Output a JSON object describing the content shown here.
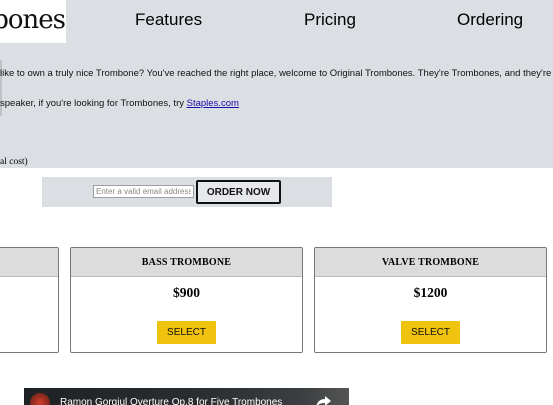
{
  "header": {
    "logo_text": "nbones",
    "nav": [
      "Features",
      "Pricing",
      "Ordering"
    ]
  },
  "intro": {
    "line1": " like to own a truly nice Trombone? You've reached the right place, welcome to Original Trombones. They're Trombones, and they're",
    "line2_prefix": "speaker, if you're looking for Trombones, try ",
    "line2_link": "Staples.com",
    "cost_note": "al cost)"
  },
  "order_form": {
    "email_placeholder": "Enter a valid email address",
    "button_label": "ORDER NOW"
  },
  "cards": [
    {
      "title": "",
      "price": "",
      "button": ""
    },
    {
      "title": "BASS TROMBONE",
      "price": "$900",
      "button": "SELECT"
    },
    {
      "title": "VALVE TROMBONE",
      "price": "$1200",
      "button": "SELECT"
    }
  ],
  "video": {
    "title": "Ramon Gorgiul Overture Op.8 for Five Trombones",
    "share_icon": "share-icon",
    "channel_icon": "channel-avatar"
  },
  "colors": {
    "header_bg": "#dbdee3",
    "select_button": "#f0c30e",
    "link": "#1a0dab"
  }
}
